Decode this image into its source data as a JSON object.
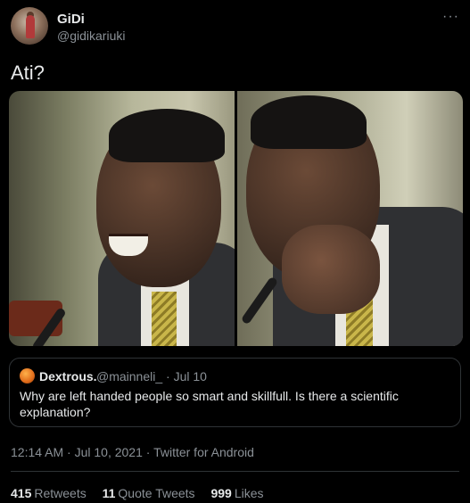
{
  "author": {
    "name": "GiDi",
    "handle": "@gidikariuki"
  },
  "more_icon": "more-horizontal-icon",
  "tweet": {
    "text": "Ati?"
  },
  "quoted_tweet": {
    "name": "Dextrous.",
    "handle": "@mainneli_ · Jul 10",
    "text": "Why are left handed people so smart and skillfull. Is there a scientific explanation?"
  },
  "meta": {
    "timestamp": "12:14 AM · Jul 10, 2021 · Twitter for Android"
  },
  "stats": {
    "retweets_count": "415",
    "retweets_label": "Retweets",
    "quotes_count": "11",
    "quotes_label": "Quote Tweets",
    "likes_count": "999",
    "likes_label": "Likes"
  },
  "colors": {
    "background": "#000000",
    "text_primary": "#e7e9ea",
    "text_secondary": "#8b9197",
    "border": "#2f3336"
  }
}
